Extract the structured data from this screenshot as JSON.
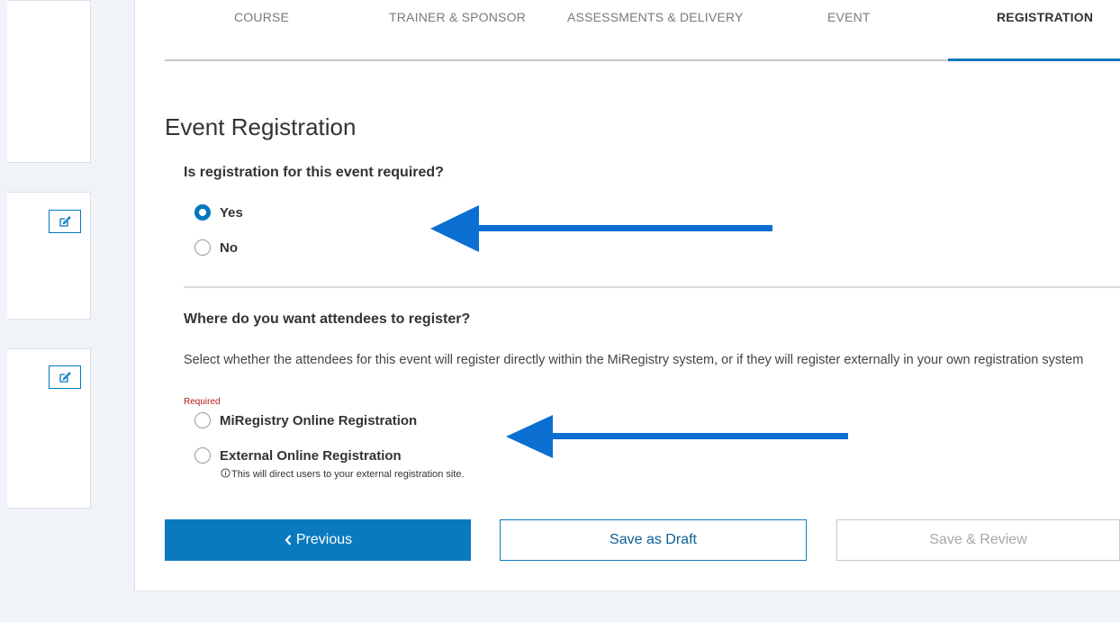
{
  "tabs": [
    {
      "label": "COURSE",
      "active": false
    },
    {
      "label": "TRAINER & SPONSOR",
      "active": false
    },
    {
      "label": "ASSESSMENTS & DELIVERY",
      "active": false
    },
    {
      "label": "EVENT",
      "active": false
    },
    {
      "label": "REGISTRATION",
      "active": true
    }
  ],
  "sidebar": {
    "edit_icons": [
      "edit-icon",
      "edit-icon"
    ]
  },
  "form": {
    "title": "Event Registration",
    "q1": {
      "question": "Is registration for this event required?",
      "options": [
        "Yes",
        "No"
      ],
      "selected": "Yes"
    },
    "q2": {
      "question": "Where do you want attendees to register?",
      "description": "Select whether the attendees for this event will register directly within the MiRegistry system, or if they will register externally in your own registration system",
      "required_label": "Required",
      "options": [
        "MiRegistry Online Registration",
        "External Online Registration"
      ],
      "selected": null,
      "hint": "This will direct users to your external registration site."
    }
  },
  "buttons": {
    "previous": "Previous",
    "save_draft": "Save as Draft",
    "save_review": "Save & Review"
  },
  "colors": {
    "accent": "#0277bd",
    "arrow": "#0a6fd0",
    "required": "#b71c1c"
  }
}
